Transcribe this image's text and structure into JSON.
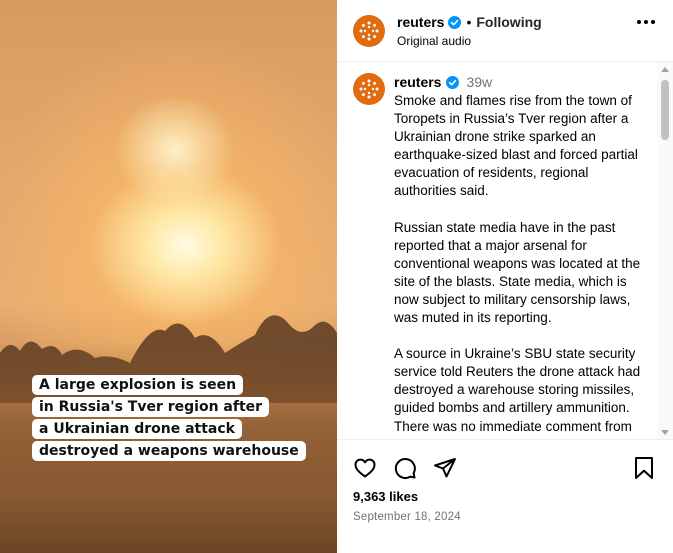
{
  "video": {
    "caption_lines": [
      "A large explosion is seen",
      "in Russia's Tver region after",
      "a Ukrainian drone attack",
      "destroyed a weapons warehouse"
    ]
  },
  "header": {
    "username": "reuters",
    "follow_status": "Following",
    "audio_label": "Original audio",
    "separator": "•"
  },
  "post": {
    "username": "reuters",
    "time_ago": "39w",
    "paragraphs": [
      "Smoke and flames rise from the town of Toropets in Russia’s Tver region after a Ukrainian drone strike sparked an earthquake-sized blast and forced partial evacuation of residents, regional authorities said.",
      "Russian state media have in the past reported that a major arsenal for conventional weapons was located at the site of the blasts. State media, which is now subject to military censorship laws, was muted in its reporting.",
      "A source in Ukraine’s SBU state security service told Reuters the drone attack had destroyed a warehouse storing missiles, guided bombs and artillery ammunition. There was no immediate comment from the Ukrainian government."
    ]
  },
  "stats": {
    "likes": "9,363 likes",
    "date": "September 18, 2024"
  },
  "colors": {
    "brand_avatar": "#e06b10",
    "verified_blue": "#0095f6",
    "muted_text": "#737373"
  },
  "icons": [
    "verified-badge-icon",
    "more-options-icon",
    "heart-icon",
    "comment-icon",
    "share-icon",
    "bookmark-icon",
    "scroll-up-icon",
    "scroll-down-icon"
  ]
}
